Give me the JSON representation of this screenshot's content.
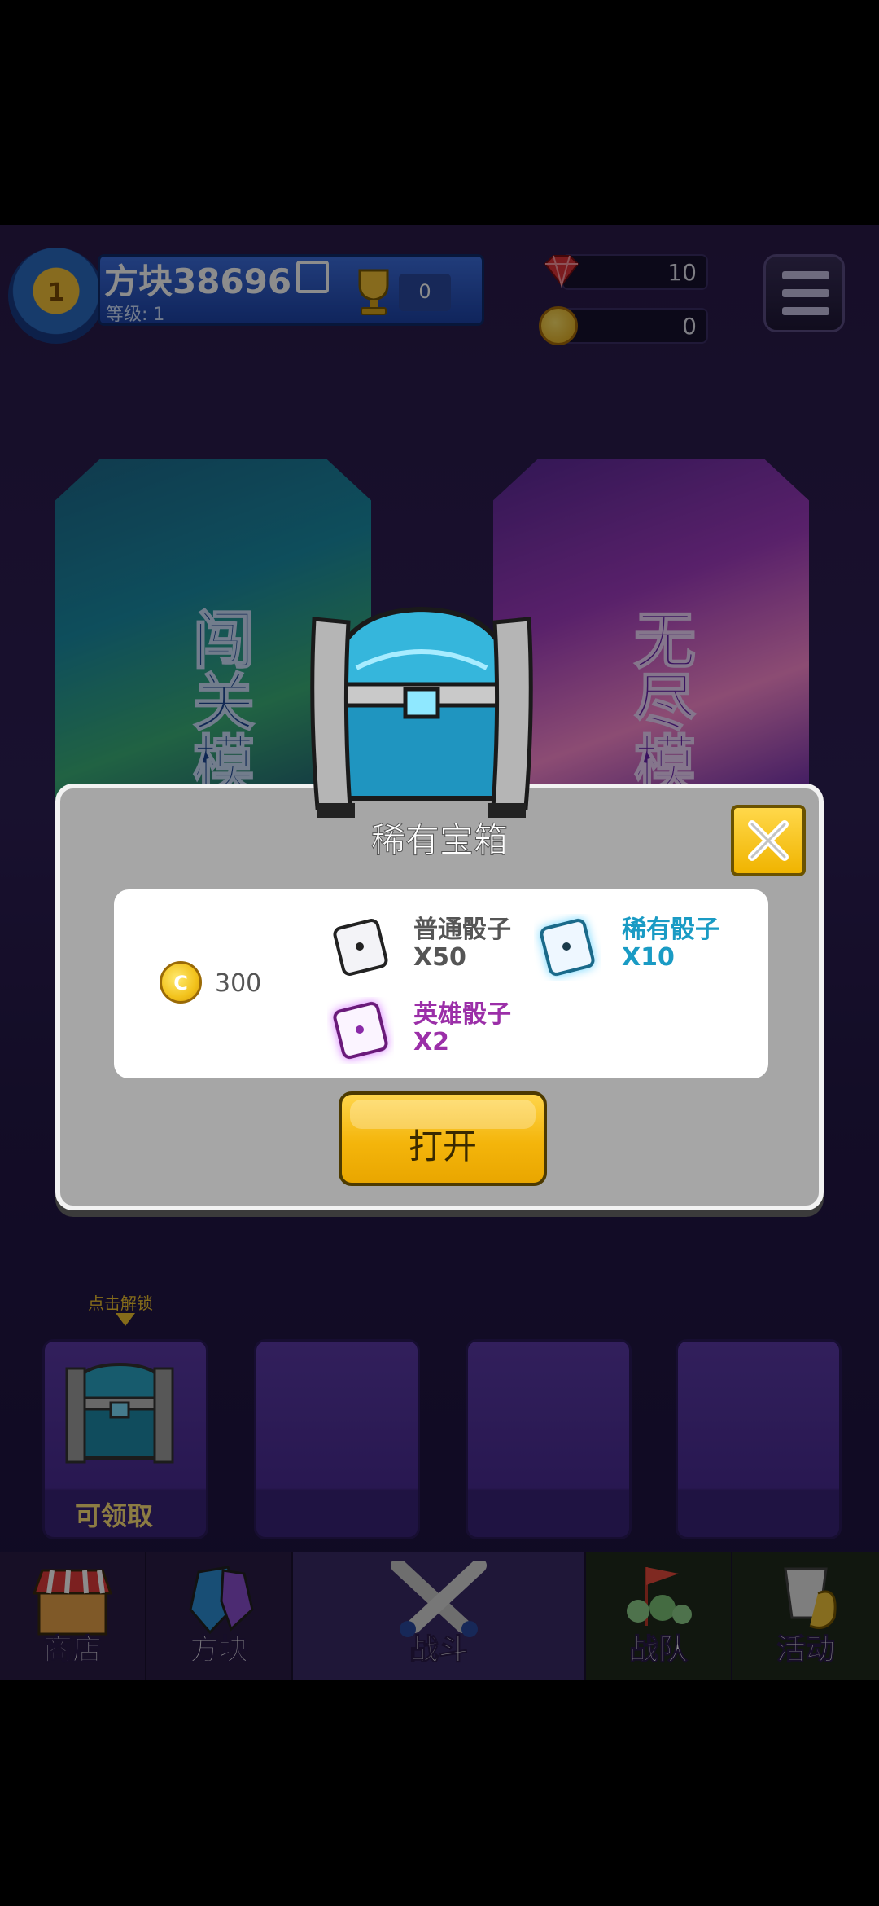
{
  "player": {
    "level": "1",
    "name": "方块38696",
    "level_label": "等级: 1",
    "trophies": "0"
  },
  "resources": {
    "gems": "10",
    "coins": "0"
  },
  "modes": {
    "stage": "闯关模",
    "endless": "无尽模"
  },
  "chest_slots": {
    "unlock_hint": "点击解锁",
    "slot1_label": "可领取"
  },
  "nav": {
    "shop": "商店",
    "blocks": "方块",
    "battle": "战斗",
    "team": "战队",
    "events": "活动"
  },
  "modal": {
    "title": "稀有宝箱",
    "coin_symbol": "C",
    "coin_amount": "300",
    "items": [
      {
        "name": "普通骰子",
        "qty": "X50",
        "color": "#555555"
      },
      {
        "name": "稀有骰子",
        "qty": "X10",
        "color": "#1a9bc4"
      },
      {
        "name": "英雄骰子",
        "qty": "X2",
        "color": "#9b2fa8"
      }
    ],
    "open_label": "打开"
  }
}
